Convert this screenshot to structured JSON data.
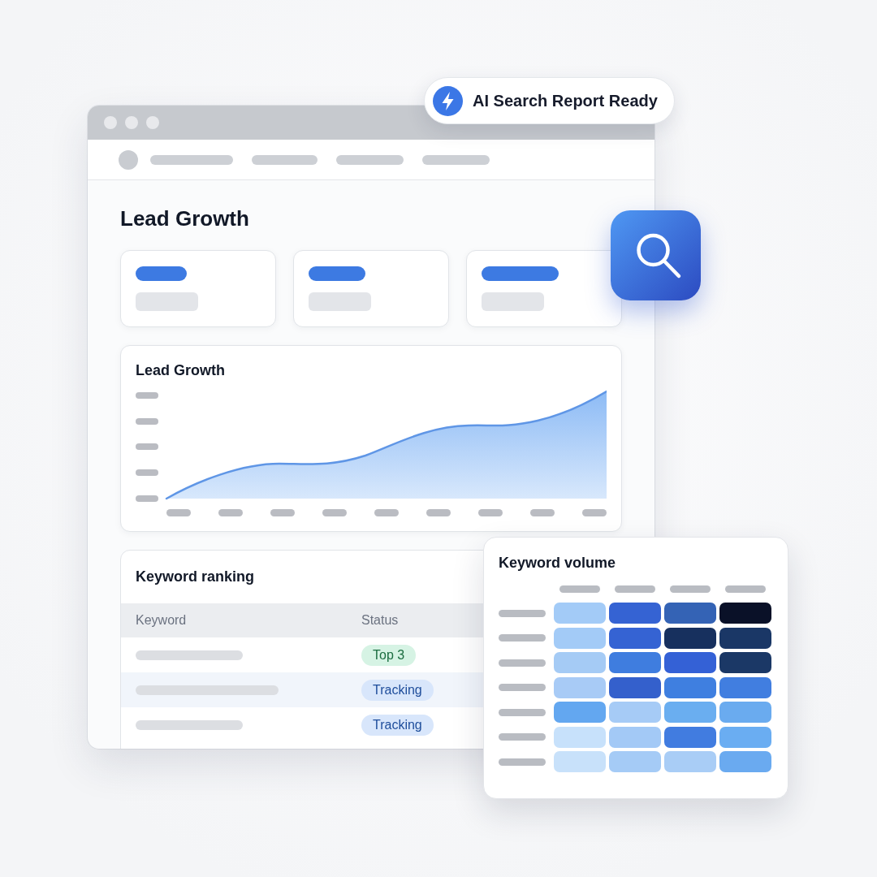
{
  "notification": {
    "text": "AI Search Report Ready"
  },
  "dashboard": {
    "title": "Lead Growth",
    "growth_chart": {
      "title": "Lead Growth"
    },
    "keyword_ranking": {
      "title": "Keyword ranking",
      "columns": [
        "Keyword",
        "Status"
      ],
      "rows": [
        {
          "status": "Top 3",
          "kind": "top"
        },
        {
          "status": "Tracking",
          "kind": "tracking"
        },
        {
          "status": "Tracking",
          "kind": "tracking"
        }
      ]
    }
  },
  "keyword_volume": {
    "title": "Keyword volume",
    "rows": [
      {
        "cells": [
          {
            "color": "#a3cbf7"
          },
          {
            "color": "#3563d3"
          },
          {
            "color": "#3463b5"
          },
          {
            "color": "#0a1128"
          }
        ]
      },
      {
        "cells": [
          {
            "color": "#a3cbf7"
          },
          {
            "color": "#3563d3"
          },
          {
            "color": "#17305e"
          },
          {
            "color": "#1a3766"
          }
        ]
      },
      {
        "cells": [
          {
            "color": "#a5cbf5"
          },
          {
            "color": "#3f7ddf"
          },
          {
            "color": "#3461d6"
          },
          {
            "color": "#1b3866"
          }
        ]
      },
      {
        "cells": [
          {
            "color": "#a8cbf6"
          },
          {
            "color": "#3460cc"
          },
          {
            "color": "#3f7fe0"
          },
          {
            "color": "#417ee0"
          }
        ]
      },
      {
        "cells": [
          {
            "color": "#63a7f0"
          },
          {
            "color": "#a6cbf6"
          },
          {
            "color": "#6aaef0"
          },
          {
            "color": "#6aabef"
          }
        ]
      },
      {
        "cells": [
          {
            "color": "#c7e1fb"
          },
          {
            "color": "#a3c9f6"
          },
          {
            "color": "#417ce0"
          },
          {
            "color": "#6aadf2"
          }
        ]
      },
      {
        "cells": [
          {
            "color": "#c8e1fa"
          },
          {
            "color": "#a5cbf6"
          },
          {
            "color": "#a9cdf6"
          },
          {
            "color": "#6aaaf0"
          }
        ]
      }
    ]
  }
}
